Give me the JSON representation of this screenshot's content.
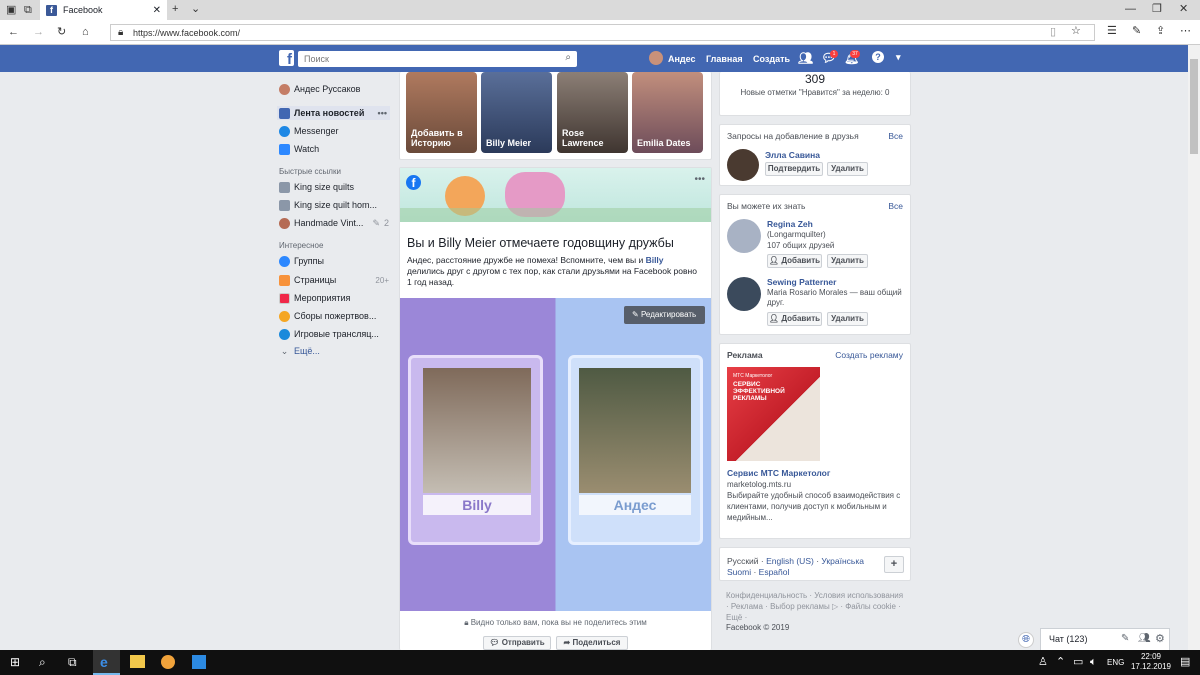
{
  "browser": {
    "tab_title": "Facebook",
    "url": "https://www.facebook.com/"
  },
  "topbar": {
    "search_placeholder": "Поиск",
    "user_name": "Андес",
    "home": "Главная",
    "create": "Создать",
    "messages_badge": "1",
    "notifications_badge": "37"
  },
  "left_nav": {
    "profile": "Андес Руссаков",
    "feed": "Лента новостей",
    "messenger": "Messenger",
    "watch": "Watch",
    "shortcuts_header": "Быстрые ссылки",
    "shortcuts": [
      {
        "label": "King size quilts"
      },
      {
        "label": "King size quilt hom..."
      },
      {
        "label": "Handmade Vint...",
        "count": "2"
      }
    ],
    "explore_header": "Интересное",
    "explore": [
      {
        "label": "Группы",
        "count": ""
      },
      {
        "label": "Страницы",
        "count": "20+"
      },
      {
        "label": "Мероприятия",
        "count": ""
      },
      {
        "label": "Сборы пожертвов...",
        "count": ""
      },
      {
        "label": "Игровые трансляц...",
        "count": ""
      }
    ],
    "more": "Ещё..."
  },
  "stories": [
    {
      "label": "Добавить в Историю"
    },
    {
      "label": "Billy Meier"
    },
    {
      "label": "Rose Lawrence"
    },
    {
      "label": "Emilia Dates"
    }
  ],
  "memory": {
    "title": "Вы и Billy Meier отмечаете годовщину дружбы",
    "text_before": "Андес, расстояние дружбе не помеха! Вспомните, чем вы и ",
    "text_link": "Billy",
    "text_after": " делились друг с другом с тех пор, как стали друзьями на Facebook ровно 1 год назад.",
    "edit_button": "Редактировать",
    "name_left": "Billy",
    "name_right": "Андес",
    "privacy": "Видно только вам, пока вы не поделитесь этим",
    "send_button": "Отправить",
    "share_button": "Поделиться"
  },
  "page_stats": {
    "likes": "309",
    "weekly": "Новые отметки \"Нравится\" за неделю: 0"
  },
  "friend_requests": {
    "title": "Запросы на добавление в друзья",
    "all": "Все",
    "name": "Элла Савина",
    "confirm": "Подтвердить",
    "delete": "Удалить"
  },
  "pymk": {
    "title": "Вы можете их знать",
    "all": "Все",
    "people": [
      {
        "name": "Regina Zeh",
        "line1": "(Longarmquilter)",
        "line2": "107 общих друзей"
      },
      {
        "name": "Sewing Patterner",
        "line1": "Maria Rosario Morales — ваш общий",
        "line2": "друг."
      }
    ],
    "add": "Добавить",
    "delete": "Удалить"
  },
  "ads": {
    "title": "Реклама",
    "create": "Создать рекламу",
    "image_brand": "МТС Маркетолог",
    "image_line1": "СЕРВИС",
    "image_line2": "ЭФФЕКТИВНОЙ",
    "image_line3": "РЕКЛАМЫ",
    "ad_title": "Сервис МТС Маркетолог",
    "ad_domain": "marketolog.mts.ru",
    "ad_text": "Выбирайте удобный способ взаимодействия с клиентами, получив доступ к мобильным и медийным..."
  },
  "languages": {
    "current": "Русский",
    "items": [
      "English (US)",
      "Українська",
      "Suomi",
      "Español"
    ]
  },
  "footer": {
    "links": "Конфиденциальность · Условия использования · Реклама · Выбор рекламы ▷ · Файлы cookie · Ещё ·",
    "copyright": "Facebook © 2019"
  },
  "chat": {
    "label": "Чат (123)"
  },
  "taskbar": {
    "lang": "ENG",
    "time": "22:09",
    "date": "17.12.2019"
  },
  "colors": {
    "brand": "#4267b2",
    "link": "#385898"
  }
}
